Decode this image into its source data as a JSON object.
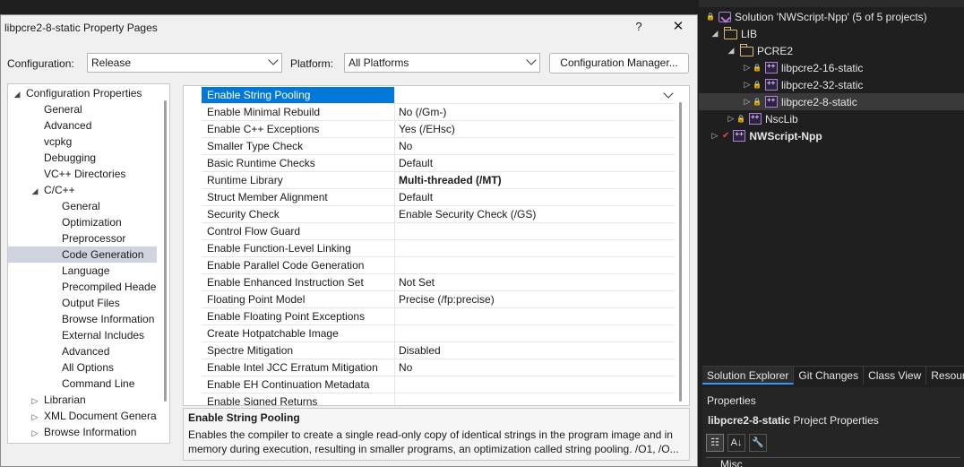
{
  "dialog": {
    "title": "libpcre2-8-static Property Pages",
    "help_glyph": "?",
    "close_glyph": "✕",
    "configuration_label": "Configuration:",
    "configuration_value": "Release",
    "platform_label": "Platform:",
    "platform_value": "All Platforms",
    "config_manager_label": "Configuration Manager...",
    "tree": [
      {
        "label": "Configuration Properties",
        "arrow": "◢"
      },
      {
        "label": "General"
      },
      {
        "label": "Advanced"
      },
      {
        "label": "vcpkg"
      },
      {
        "label": "Debugging"
      },
      {
        "label": "VC++ Directories"
      },
      {
        "label": "C/C++",
        "arrow": "◢"
      },
      {
        "label": "General"
      },
      {
        "label": "Optimization"
      },
      {
        "label": "Preprocessor"
      },
      {
        "label": "Code Generation",
        "selected": true
      },
      {
        "label": "Language"
      },
      {
        "label": "Precompiled Heade"
      },
      {
        "label": "Output Files"
      },
      {
        "label": "Browse Information"
      },
      {
        "label": "External Includes"
      },
      {
        "label": "Advanced"
      },
      {
        "label": "All Options"
      },
      {
        "label": "Command Line"
      },
      {
        "label": "Librarian",
        "arrow": "▷"
      },
      {
        "label": "XML Document Genera",
        "arrow": "▷"
      },
      {
        "label": "Browse Information",
        "arrow": "▷"
      }
    ],
    "properties": [
      {
        "name": "Enable String Pooling",
        "value": "",
        "selected": true
      },
      {
        "name": "Enable Minimal Rebuild",
        "value": "No (/Gm-)"
      },
      {
        "name": "Enable C++ Exceptions",
        "value": "Yes (/EHsc)"
      },
      {
        "name": "Smaller Type Check",
        "value": "No"
      },
      {
        "name": "Basic Runtime Checks",
        "value": "Default"
      },
      {
        "name": "Runtime Library",
        "value": "Multi-threaded (/MT)",
        "bold": true
      },
      {
        "name": "Struct Member Alignment",
        "value": "Default"
      },
      {
        "name": "Security Check",
        "value": "Enable Security Check (/GS)"
      },
      {
        "name": "Control Flow Guard",
        "value": ""
      },
      {
        "name": "Enable Function-Level Linking",
        "value": ""
      },
      {
        "name": "Enable Parallel Code Generation",
        "value": ""
      },
      {
        "name": "Enable Enhanced Instruction Set",
        "value": "Not Set"
      },
      {
        "name": "Floating Point Model",
        "value": "Precise (/fp:precise)"
      },
      {
        "name": "Enable Floating Point Exceptions",
        "value": ""
      },
      {
        "name": "Create Hotpatchable Image",
        "value": ""
      },
      {
        "name": "Spectre Mitigation",
        "value": "Disabled"
      },
      {
        "name": "Enable Intel JCC Erratum Mitigation",
        "value": "No"
      },
      {
        "name": "Enable EH Continuation Metadata",
        "value": ""
      },
      {
        "name": "Enable Signed Returns",
        "value": ""
      }
    ],
    "description_title": "Enable String Pooling",
    "description_body": "Enables the compiler to create a single read-only copy of identical strings in the program image and in memory during execution, resulting in smaller programs, an optimization called string pooling. /O1, /O..."
  },
  "solution_explorer": {
    "items": [
      {
        "label": "Solution 'NWScript-Npp' (5 of 5 projects)",
        "icon": "solution-icon",
        "lock": true
      },
      {
        "label": "LIB",
        "icon": "folder-icon",
        "arrow": "◢"
      },
      {
        "label": "PCRE2",
        "icon": "folder-icon",
        "arrow": "◢"
      },
      {
        "label": "libpcre2-16-static",
        "icon": "cpp-project-icon",
        "arrow": "▷",
        "lock": true
      },
      {
        "label": "libpcre2-32-static",
        "icon": "cpp-project-icon",
        "arrow": "▷",
        "lock": true
      },
      {
        "label": "libpcre2-8-static",
        "icon": "cpp-project-icon",
        "arrow": "▷",
        "lock": true,
        "selected": true
      },
      {
        "label": "NscLib",
        "icon": "cpp-project-icon",
        "arrow": "▷",
        "lock": true
      },
      {
        "label": "NWScript-Npp",
        "icon": "cpp-project-icon",
        "arrow": "▷",
        "bold": true,
        "check": true
      }
    ],
    "tabs": [
      "Solution Explorer",
      "Git Changes",
      "Class View",
      "Resourc"
    ],
    "properties_title": "Properties",
    "properties_object": "libpcre2-8-static",
    "properties_object_type": "Project Properties",
    "misc_label": "Misc"
  }
}
